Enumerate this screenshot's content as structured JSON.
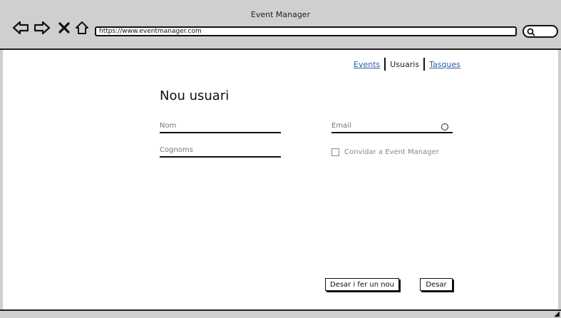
{
  "window": {
    "title": "Event Manager"
  },
  "browser": {
    "url": "https://www.eventmanager.com",
    "icons": [
      "back-arrow-icon",
      "forward-arrow-icon",
      "close-icon",
      "home-icon",
      "search-icon"
    ]
  },
  "topnav": {
    "items": [
      {
        "label": "Events",
        "active": false
      },
      {
        "label": "Usuaris",
        "active": true
      },
      {
        "label": "Tasques",
        "active": false
      }
    ]
  },
  "form": {
    "title": "Nou usuari",
    "nom_placeholder": "Nom",
    "cognoms_placeholder": "Cognoms",
    "email_placeholder": "Email",
    "invite_label": "Convidar a Event Manager",
    "invite_checked": false
  },
  "actions": {
    "save_and_new": "Desar i fer un nou",
    "save": "Desar"
  },
  "colors": {
    "chrome": "#cfcfcf",
    "link": "#2a5fa8",
    "disabled_text": "#888888"
  }
}
